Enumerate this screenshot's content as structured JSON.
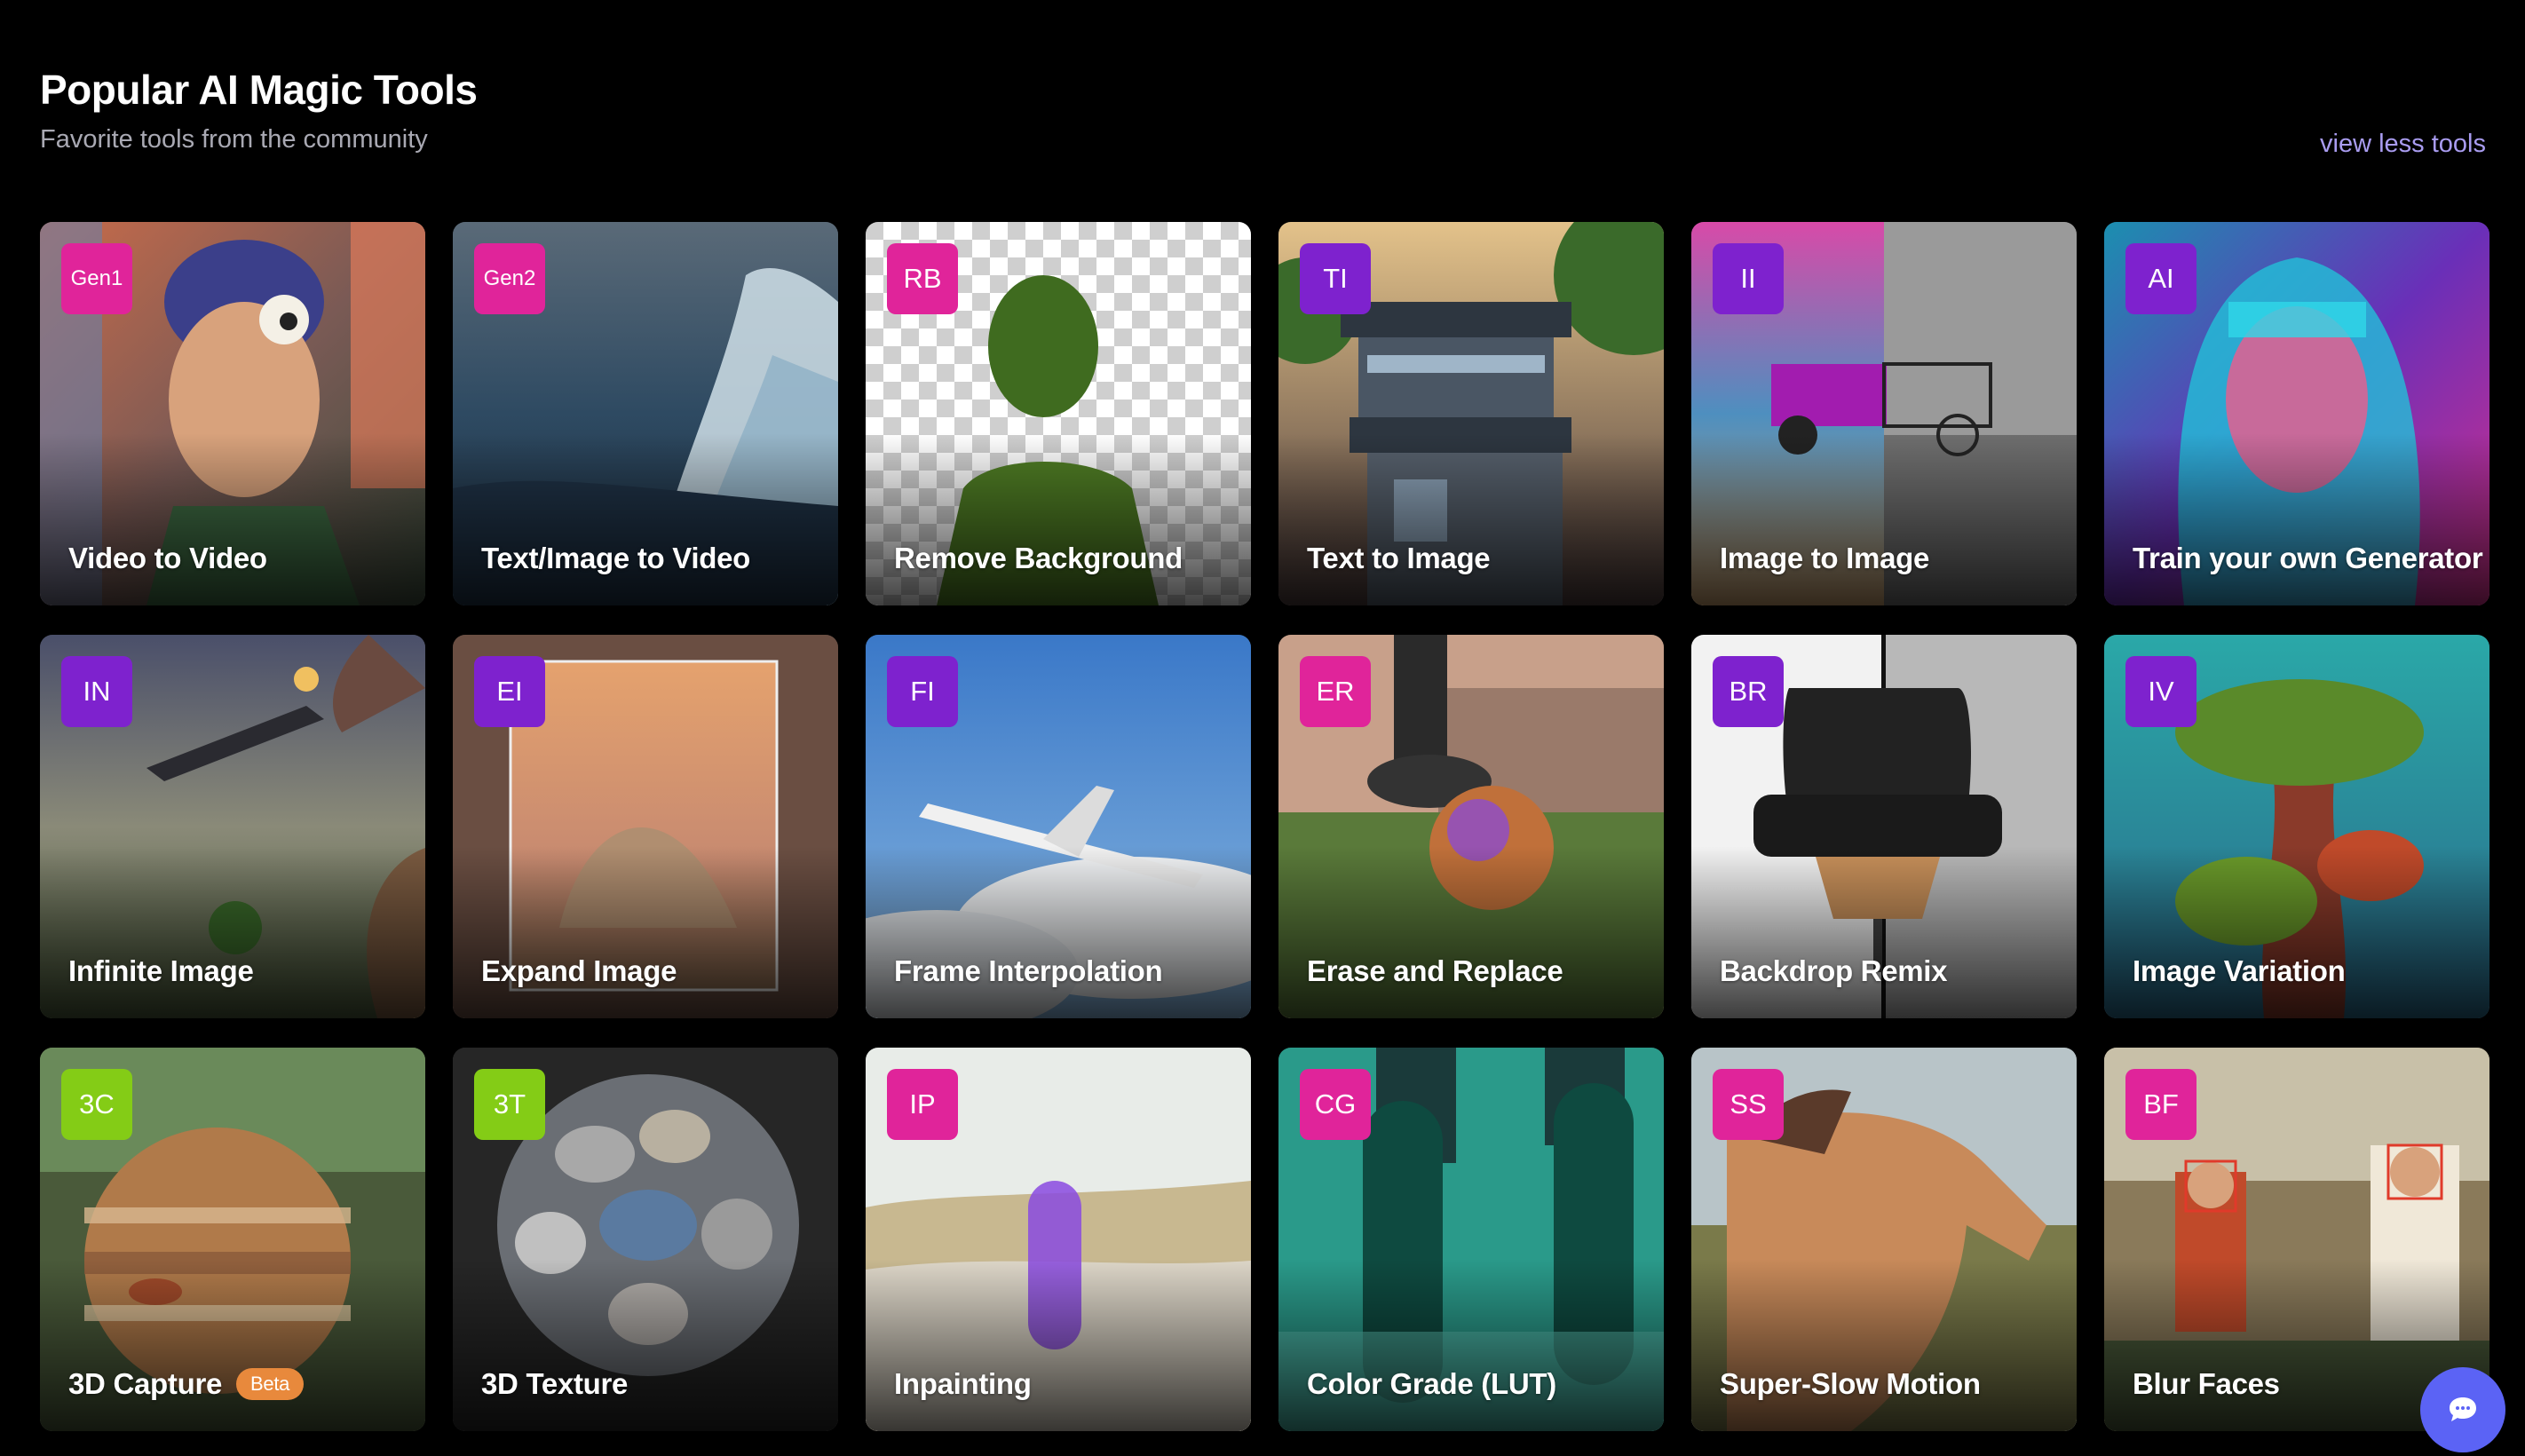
{
  "header": {
    "title": "Popular AI Magic Tools",
    "subtitle": "Favorite tools from the community",
    "view_less": "view less tools"
  },
  "colors": {
    "pink": "#e0249a",
    "purple": "#7e22ce",
    "lime": "#84cc16",
    "chat": "#5b63f5",
    "beta": "#e8893c"
  },
  "tools": [
    {
      "badge": "Gen1",
      "label": "Video to Video",
      "badge_color": "pink",
      "image": "animated-character"
    },
    {
      "badge": "Gen2",
      "label": "Text/Image to Video",
      "badge_color": "pink",
      "image": "ocean-wave"
    },
    {
      "badge": "RB",
      "label": "Remove Background",
      "badge_color": "pink",
      "image": "woman-transparent-background"
    },
    {
      "badge": "TI",
      "label": "Text to Image",
      "badge_color": "purple",
      "image": "modern-house"
    },
    {
      "badge": "II",
      "label": "Image to Image",
      "badge_color": "purple",
      "image": "jeep-sketch"
    },
    {
      "badge": "AI",
      "label": "Train your own Generator",
      "badge_color": "purple",
      "image": "neon-portrait"
    },
    {
      "badge": "IN",
      "label": "Infinite Image",
      "badge_color": "purple",
      "image": "surreal-spaceship"
    },
    {
      "badge": "EI",
      "label": "Expand Image",
      "badge_color": "purple",
      "image": "desert-rock"
    },
    {
      "badge": "FI",
      "label": "Frame Interpolation",
      "badge_color": "purple",
      "image": "airplane-sky"
    },
    {
      "badge": "ER",
      "label": "Erase and Replace",
      "badge_color": "pink",
      "image": "soccer-ball"
    },
    {
      "badge": "BR",
      "label": "Backdrop Remix",
      "badge_color": "purple",
      "image": "lounge-chair"
    },
    {
      "badge": "IV",
      "label": "Image Variation",
      "badge_color": "purple",
      "image": "mossy-tree"
    },
    {
      "badge": "3C",
      "label": "3D Capture",
      "badge_color": "lime",
      "image": "jupiter-sphere",
      "tag": "Beta"
    },
    {
      "badge": "3T",
      "label": "3D Texture",
      "badge_color": "lime",
      "image": "stone-sphere"
    },
    {
      "badge": "IP",
      "label": "Inpainting",
      "badge_color": "pink",
      "image": "dune-figure"
    },
    {
      "badge": "CG",
      "label": "Color Grade (LUT)",
      "badge_color": "pink",
      "image": "skateboards"
    },
    {
      "badge": "SS",
      "label": "Super-Slow Motion",
      "badge_color": "pink",
      "image": "horse-rider"
    },
    {
      "badge": "BF",
      "label": "Blur Faces",
      "badge_color": "pink",
      "image": "cafe-people"
    }
  ],
  "chat_icon": "chat-bubble-icon"
}
